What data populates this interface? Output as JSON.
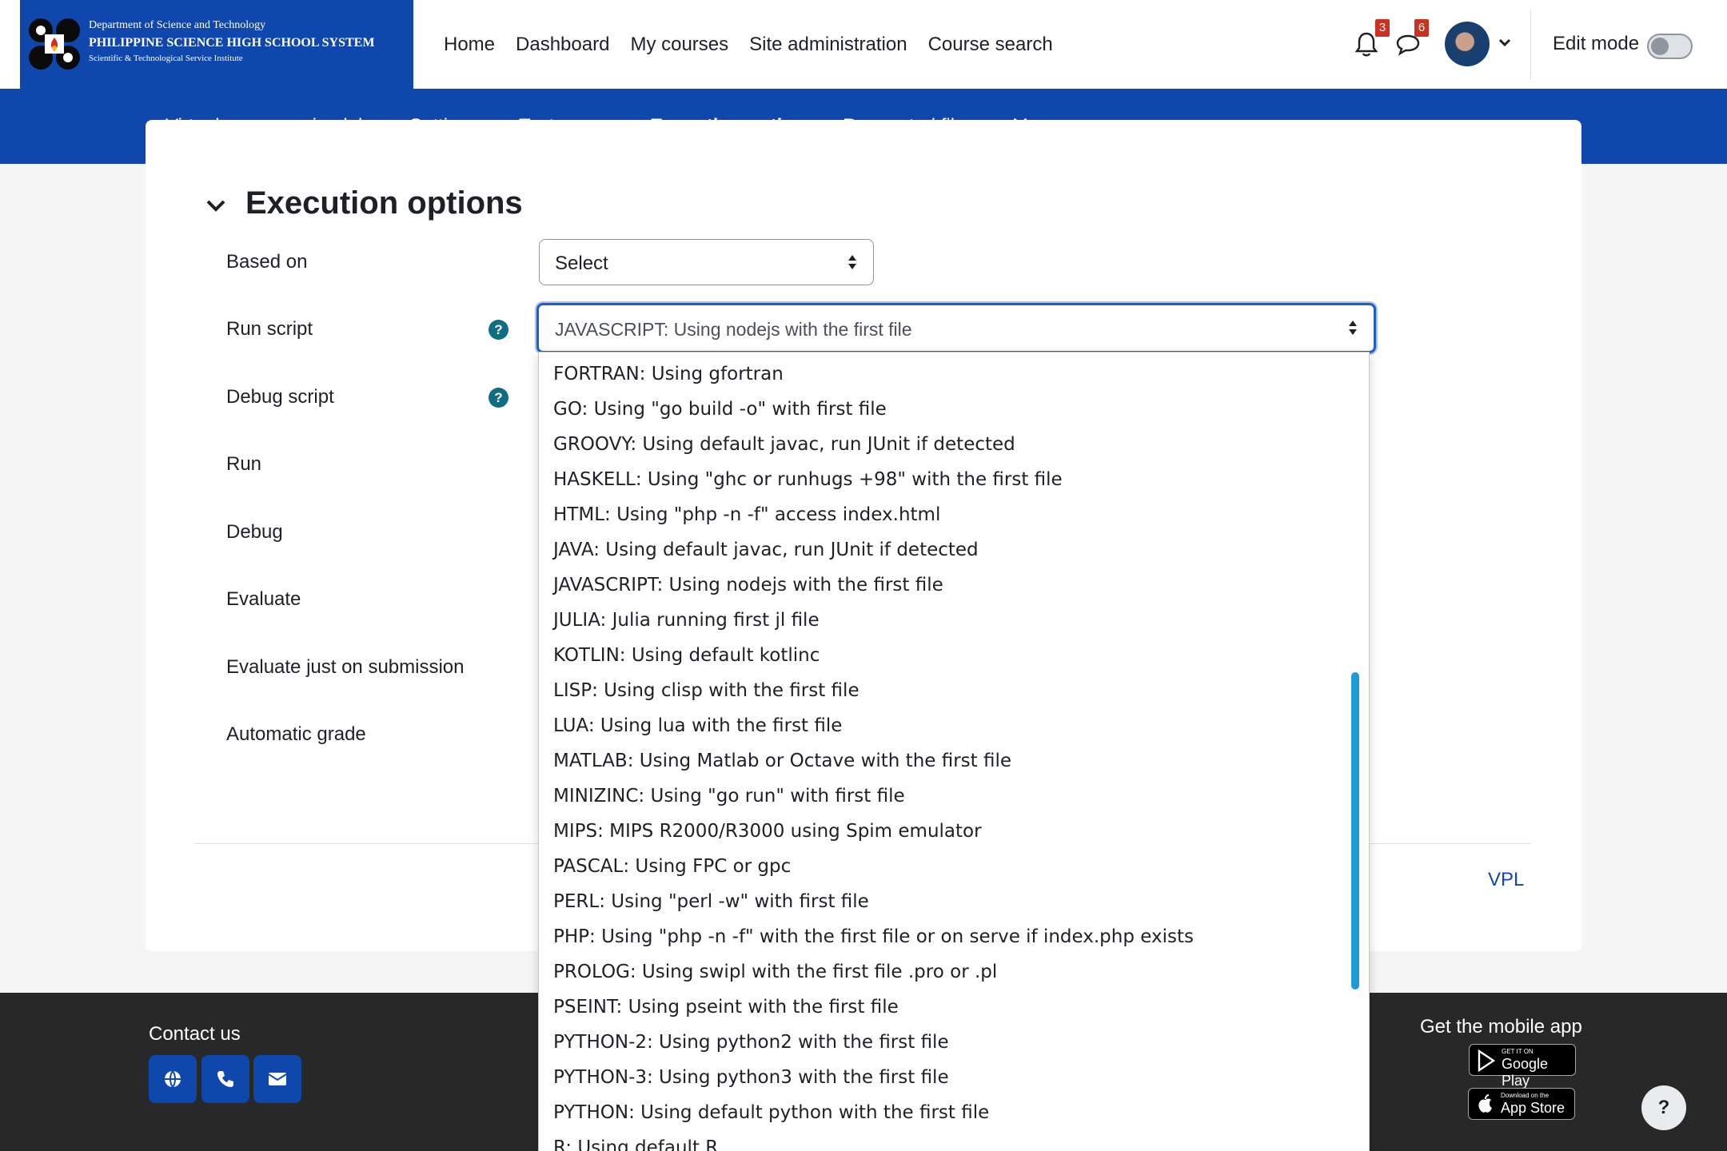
{
  "brand": {
    "line1": "Department of Science and Technology",
    "line2": "PHILIPPINE SCIENCE HIGH SCHOOL SYSTEM",
    "line3": "Scientific & Technological Service Institute"
  },
  "primary_nav": [
    "Home",
    "Dashboard",
    "My courses",
    "Site administration",
    "Course search"
  ],
  "notifications": {
    "count": "3"
  },
  "messages": {
    "count": "6"
  },
  "edit_mode": {
    "label": "Edit mode",
    "enabled": false
  },
  "secondary_nav": {
    "items": [
      "Virtual programming lab",
      "Settings",
      "Test cases",
      "Execution options",
      "Requested files"
    ],
    "more": "More",
    "active": "Execution options"
  },
  "section": {
    "title": "Execution options"
  },
  "form": {
    "based_on_label": "Based on",
    "based_on_value": "Select",
    "run_script_label": "Run script",
    "run_script_value": "JAVASCRIPT: Using nodejs with the first file",
    "debug_script_label": "Debug script",
    "run_label": "Run",
    "debug_label": "Debug",
    "evaluate_label": "Evaluate",
    "evaluate_submission_label": "Evaluate just on submission",
    "automatic_grade_label": "Automatic grade"
  },
  "dropdown_options": [
    "FORTRAN: Using gfortran",
    "GO: Using \"go build -o\" with first file",
    "GROOVY: Using default javac, run JUnit if detected",
    "HASKELL: Using \"ghc or runhugs +98\" with the first file",
    "HTML: Using \"php -n -f\" access index.html",
    "JAVA: Using default javac, run JUnit if detected",
    "JAVASCRIPT: Using nodejs with the first file",
    "JULIA: Julia running first jl file",
    "KOTLIN: Using default kotlinc",
    "LISP: Using clisp with the first file",
    "LUA: Using lua with the first file",
    "MATLAB: Using Matlab or Octave with the first file",
    "MINIZINC: Using \"go run\" with first file",
    "MIPS: MIPS R2000/R3000 using Spim emulator",
    "PASCAL: Using FPC or gpc",
    "PERL: Using \"perl -w\" with first file",
    "PHP: Using \"php -n -f\" with the first file or on serve if index.php exists",
    "PROLOG: Using swipl with the first file .pro or .pl",
    "PSEINT: Using pseint with the first file",
    "PYTHON-2: Using python2 with the first file",
    "PYTHON-3: Using python3 with the first file",
    "PYTHON: Using default python with the first file",
    "R: Using default R"
  ],
  "footer": {
    "contact_label": "Contact us",
    "mobile_app_label": "Get the mobile app",
    "google_play_small": "GET IT ON",
    "google_play": "Google Play",
    "app_store_small": "Download on the",
    "app_store": "App Store",
    "help": "?"
  },
  "vpl_link": "VPL",
  "colors": {
    "brand_blue": "#0f47ad",
    "badge_red": "#ca3120",
    "focus_blue": "#1e60c9",
    "scrollbar": "#1e9ad8"
  }
}
